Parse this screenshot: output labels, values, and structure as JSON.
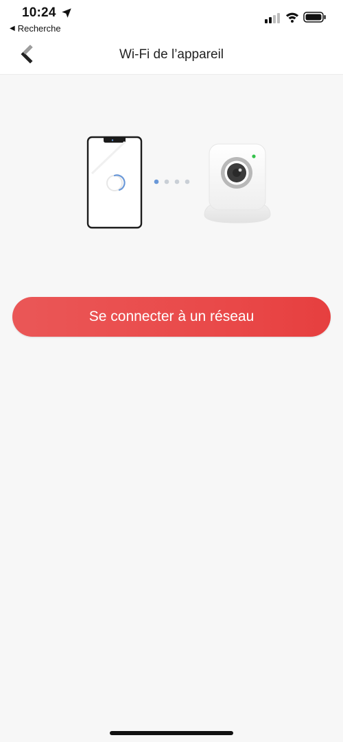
{
  "status_bar": {
    "time": "10:24",
    "back_app_label": "Recherche",
    "icons": [
      "location-arrow-icon",
      "signal-bars-icon",
      "wifi-icon",
      "battery-icon"
    ]
  },
  "nav": {
    "title": "Wi‑Fi de l’appareil",
    "back_icon": "chevron-left-icon"
  },
  "illustration": {
    "phone": "phone-with-spinner",
    "camera": "security-camera",
    "connection_dots": 4,
    "active_dot": 1,
    "colors": {
      "active_dot": "#6a98d8",
      "inactive_dot": "#c9cfd6",
      "camera_led": "#35c24b"
    }
  },
  "main": {
    "connect_button_label": "Se connecter à un réseau"
  },
  "colors": {
    "accent": "#e94848",
    "background": "#f7f7f7"
  }
}
